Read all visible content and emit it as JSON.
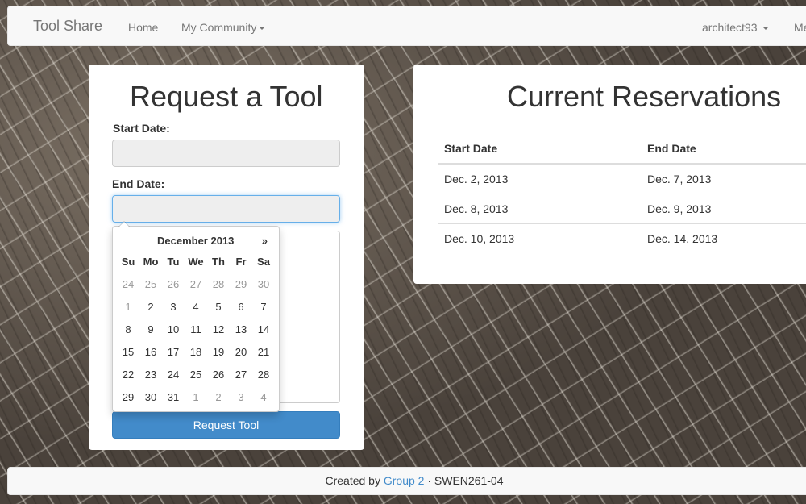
{
  "navbar": {
    "brand": "Tool Share",
    "home": "Home",
    "community": "My Community",
    "user": "architect93",
    "overflow": "Me"
  },
  "request": {
    "title": "Request a Tool",
    "start_label": "Start Date:",
    "end_label": "End Date:",
    "start_value": "",
    "end_value": "",
    "submit": "Request Tool"
  },
  "datepicker": {
    "month": "December 2013",
    "next": "»",
    "weekdays": [
      "Su",
      "Mo",
      "Tu",
      "We",
      "Th",
      "Fr",
      "Sa"
    ],
    "weeks": [
      [
        "24",
        "25",
        "26",
        "27",
        "28",
        "29",
        "30"
      ],
      [
        "1",
        "2",
        "3",
        "4",
        "5",
        "6",
        "7"
      ],
      [
        "8",
        "9",
        "10",
        "11",
        "12",
        "13",
        "14"
      ],
      [
        "15",
        "16",
        "17",
        "18",
        "19",
        "20",
        "21"
      ],
      [
        "22",
        "23",
        "24",
        "25",
        "26",
        "27",
        "28"
      ],
      [
        "29",
        "30",
        "31",
        "1",
        "2",
        "3",
        "4"
      ]
    ]
  },
  "reservations": {
    "title": "Current Reservations",
    "columns": [
      "Start Date",
      "End Date"
    ],
    "rows": [
      [
        "Dec. 2, 2013",
        "Dec. 7, 2013"
      ],
      [
        "Dec. 8, 2013",
        "Dec. 9, 2013"
      ],
      [
        "Dec. 10, 2013",
        "Dec. 14, 2013"
      ]
    ]
  },
  "footer": {
    "prefix": "Created by",
    "link": "Group 2",
    "suffix": "· SWEN261-04"
  }
}
